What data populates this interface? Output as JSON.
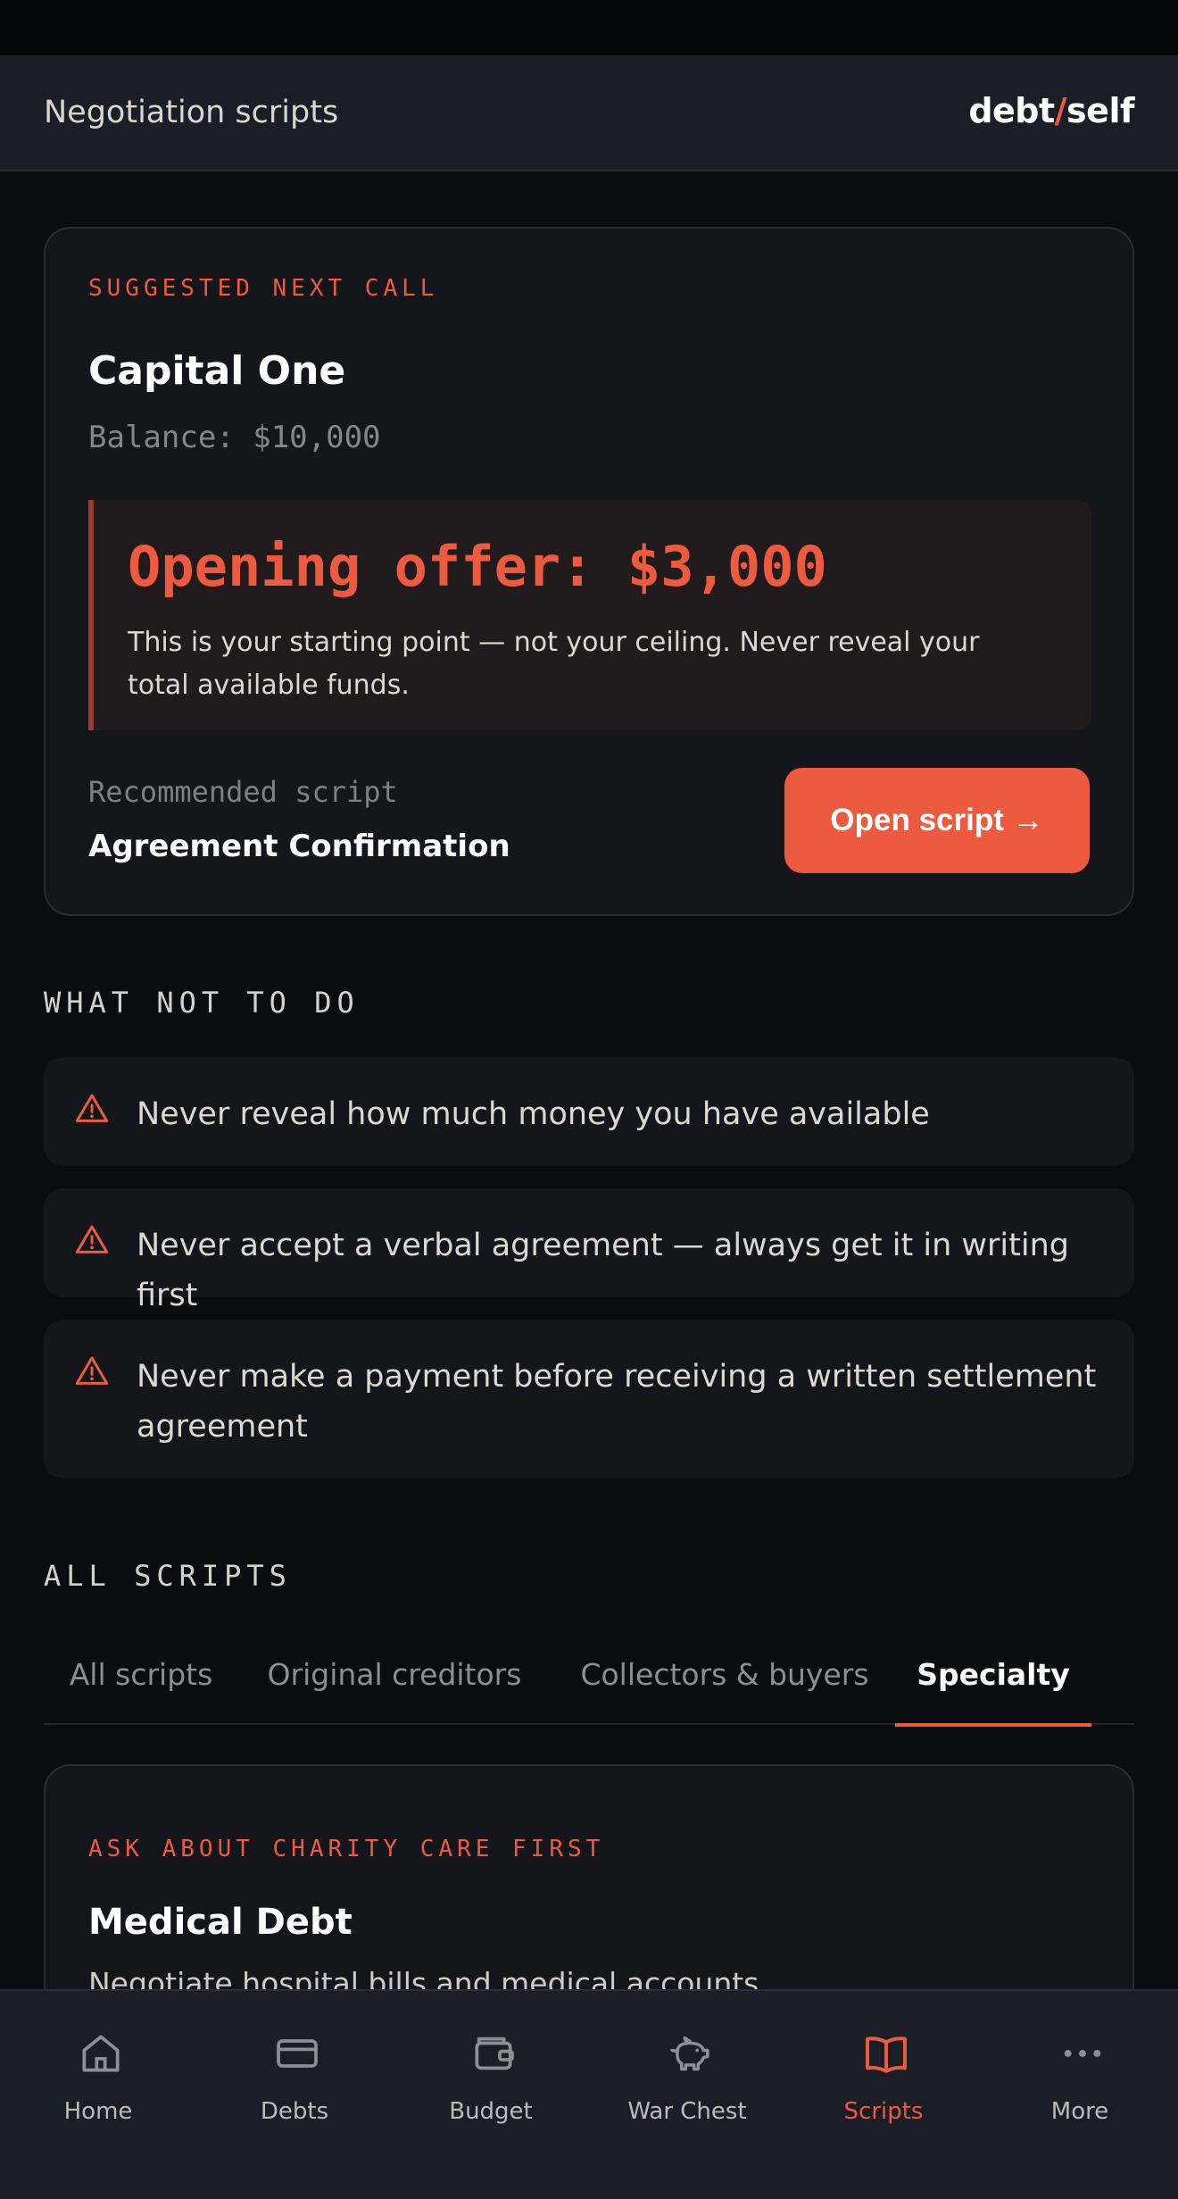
{
  "header": {
    "title": "Negotiation scripts",
    "logo_left": "debt",
    "logo_slash": "/",
    "logo_right": "self"
  },
  "suggested": {
    "eyebrow": "SUGGESTED NEXT CALL",
    "creditor": "Capital One",
    "balance": "Balance: $10,000",
    "offer": "Opening offer: $3,000",
    "offer_note": "This is your starting point — not your ceiling. Never reveal your total available funds.",
    "recommended_label": "Recommended script",
    "recommended_name": "Agreement Confirmation",
    "open_button": "Open script →"
  },
  "warnings": {
    "title": "WHAT NOT TO DO",
    "items": [
      "Never reveal how much money you have available",
      "Never accept a verbal agreement — always get it in writing first",
      "Never make a payment before receiving a written settlement agreement"
    ]
  },
  "scripts": {
    "title": "ALL SCRIPTS",
    "tabs": [
      "All scripts",
      "Original creditors",
      "Collectors & buyers",
      "Specialty"
    ],
    "active_tab": "Specialty",
    "card": {
      "eyebrow": "ASK ABOUT CHARITY CARE FIRST",
      "title": "Medical Debt",
      "description": "Negotiate hospital bills and medical accounts"
    }
  },
  "nav": {
    "items": [
      "Home",
      "Debts",
      "Budget",
      "War Chest",
      "Scripts",
      "More"
    ],
    "active": "Scripts"
  },
  "colors": {
    "accent": "#ec5b3f",
    "background": "#0a0c10",
    "surface": "#14161b",
    "bar": "#1b1e26"
  }
}
